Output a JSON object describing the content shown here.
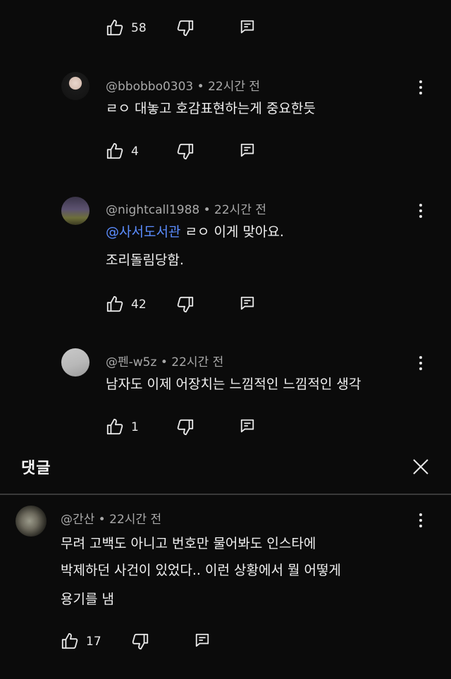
{
  "top_actions": {
    "like_count": "58"
  },
  "replies": [
    {
      "author": "@bbobbo0303",
      "time": "22시간 전",
      "lines": [
        "ㄹㅇ 대놓고 호감표현하는게 중요한듯"
      ],
      "like_count": "4"
    },
    {
      "author": "@nightcall1988",
      "time": "22시간 전",
      "mention": "@사서도서관",
      "lines": [
        "ㄹㅇ 이게 맞아요.",
        "조리돌림당함."
      ],
      "like_count": "42"
    },
    {
      "author": "@펜-w5z",
      "time": "22시간 전",
      "lines": [
        "남자도 이제 어장치는 느낌적인 느낌적인 생각"
      ],
      "like_count": "1"
    }
  ],
  "panel": {
    "title": "댓글"
  },
  "comment": {
    "author": "@간산",
    "time": "22시간 전",
    "lines": [
      "무려 고백도 아니고 번호만 물어봐도 인스타에",
      "박제하던 사건이 있었다.. 이런 상황에서 뭘 어떻게",
      "용기를 냄"
    ],
    "like_count": "17"
  },
  "colors": {
    "background": "#0b0b0b",
    "text": "#f1f1f1",
    "meta": "#a9a9a9",
    "mention": "#5b8dff",
    "divider": "#3a3a3a"
  },
  "icons": [
    "thumbs-up-icon",
    "thumbs-down-icon",
    "reply-icon",
    "more-vert-icon",
    "close-icon"
  ]
}
